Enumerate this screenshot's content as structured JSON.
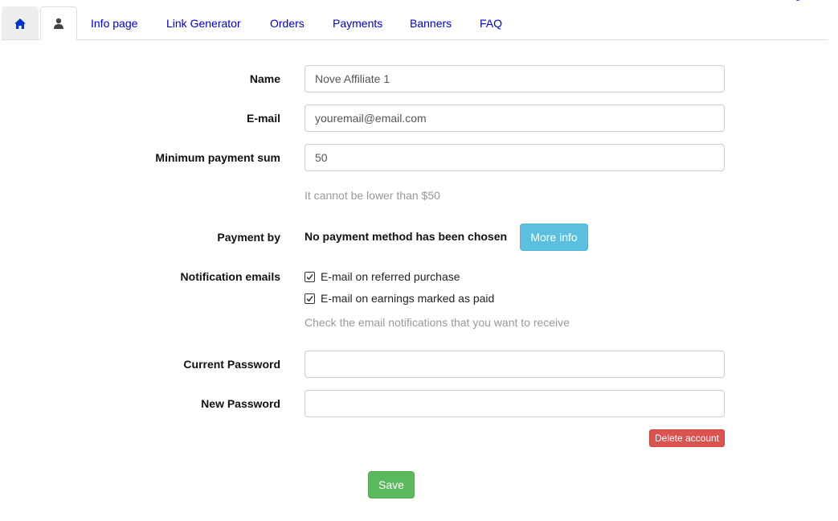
{
  "tabs": {
    "home_icon": "home-icon",
    "user_icon": "user-icon",
    "links": [
      "Info page",
      "Link Generator",
      "Orders",
      "Payments",
      "Banners",
      "FAQ"
    ]
  },
  "form": {
    "name": {
      "label": "Name",
      "value": "Nove Affiliate 1"
    },
    "email": {
      "label": "E-mail",
      "value": "youremail@email.com"
    },
    "min_payment": {
      "label": "Minimum payment sum",
      "value": "50",
      "help": "It cannot be lower than $50"
    },
    "payment": {
      "label": "Payment by",
      "text": "No payment method has been chosen",
      "button": "More info"
    },
    "notifications": {
      "label": "Notification emails",
      "options": [
        {
          "label": "E-mail on referred purchase",
          "checked": true
        },
        {
          "label": "E-mail on earnings marked as paid",
          "checked": true
        }
      ],
      "help": "Check the email notifications that you want to receive"
    },
    "current_password": {
      "label": "Current Password",
      "value": ""
    },
    "new_password": {
      "label": "New Password",
      "value": ""
    },
    "delete_label": "Delete account",
    "save_label": "Save"
  },
  "colors": {
    "link": "#0000cc",
    "info": "#5bc0de",
    "danger": "#d9534f",
    "success": "#5cb85c"
  }
}
